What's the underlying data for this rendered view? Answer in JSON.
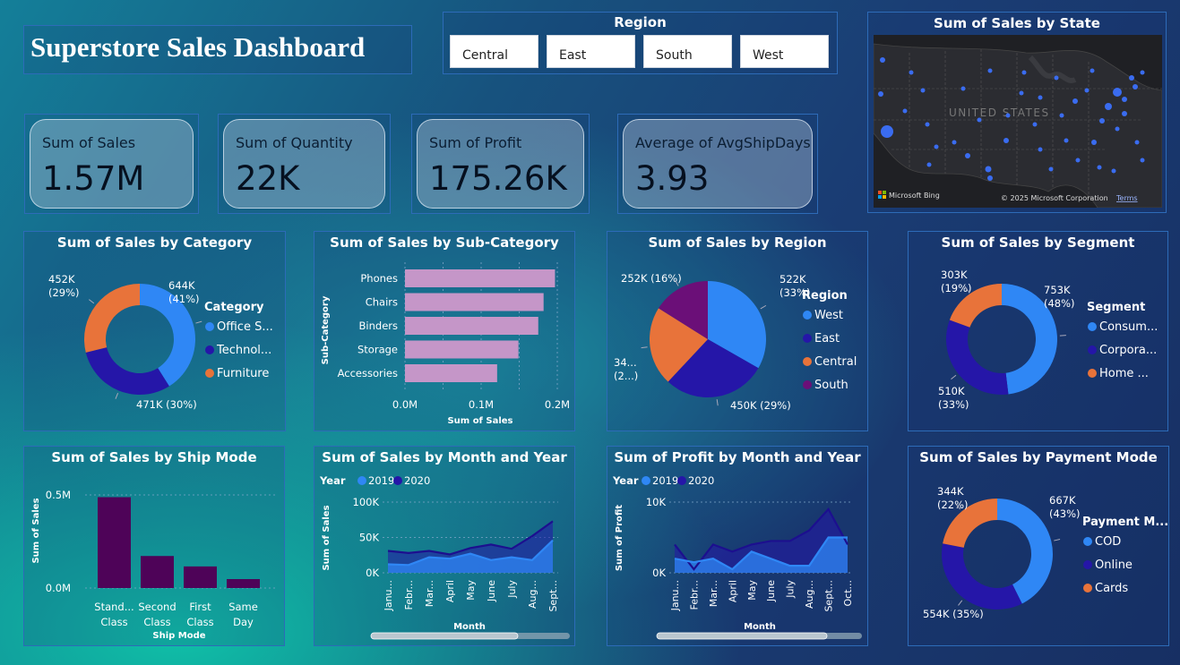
{
  "title": "Superstore Sales Dashboard",
  "region_slicer": {
    "title": "Region",
    "options": [
      "Central",
      "East",
      "South",
      "West"
    ]
  },
  "kpis": [
    {
      "label": "Sum of Sales",
      "value": "1.57M"
    },
    {
      "label": "Sum of Quantity",
      "value": "22K"
    },
    {
      "label": "Sum of Profit",
      "value": "175.26K"
    },
    {
      "label": "Average of AvgShipDays",
      "value": "3.93"
    }
  ],
  "map": {
    "title": "Sum of Sales by State",
    "country_label": "UNITED STATES",
    "bing_label": "Microsoft Bing",
    "copyright": "© 2025 Microsoft Corporation",
    "terms": "Terms"
  },
  "colors": {
    "blue": "#2f87f5",
    "navy": "#2516a8",
    "orange": "#e8733a",
    "purple": "#6b0f78",
    "bar_pink": "#c596c8",
    "bar_dark": "#4e0358"
  },
  "chart_data": [
    {
      "id": "category",
      "type": "pie",
      "title": "Sum of Sales by Category",
      "legend_title": "Category",
      "legend_items": [
        "Office S...",
        "Technol...",
        "Furniture"
      ],
      "categories": [
        "Office Supplies",
        "Technology",
        "Furniture"
      ],
      "values": [
        644,
        471,
        452
      ],
      "labels": [
        [
          "644K",
          "(41%)"
        ],
        [
          "471K (30%)"
        ],
        [
          "452K",
          "(29%)"
        ]
      ],
      "colors": [
        "#2f87f5",
        "#2516a8",
        "#e8733a"
      ]
    },
    {
      "id": "subcategory",
      "type": "bar",
      "title": "Sum of Sales by Sub-Category",
      "ylabel": "Sub-Category",
      "xlabel": "Sum of Sales",
      "categories": [
        "Phones",
        "Chairs",
        "Binders",
        "Storage",
        "Accessories"
      ],
      "values": [
        0.197,
        0.182,
        0.175,
        0.149,
        0.121
      ],
      "xticks": [
        "0.0M",
        "0.1M",
        "0.2M"
      ],
      "xlim": [
        0,
        0.2
      ]
    },
    {
      "id": "region",
      "type": "pie",
      "title": "Sum of Sales by Region",
      "legend_title": "Region",
      "legend_items": [
        "West",
        "East",
        "Central",
        "South"
      ],
      "values": [
        522,
        450,
        345,
        252
      ],
      "labels": [
        [
          "522K",
          "(33%)"
        ],
        [
          "450K (29%)"
        ],
        [
          "34...",
          "(2...)"
        ],
        [
          "252K (16%)"
        ]
      ],
      "colors": [
        "#2f87f5",
        "#2516a8",
        "#e8733a",
        "#6b0f78"
      ]
    },
    {
      "id": "segment",
      "type": "pie",
      "title": "Sum of Sales by Segment",
      "legend_title": "Segment",
      "legend_items": [
        "Consum...",
        "Corpora...",
        "Home ..."
      ],
      "values": [
        753,
        510,
        303
      ],
      "labels": [
        [
          "753K",
          "(48%)"
        ],
        [
          "510K",
          "(33%)"
        ],
        [
          "303K",
          "(19%)"
        ]
      ],
      "colors": [
        "#2f87f5",
        "#2516a8",
        "#e8733a"
      ]
    },
    {
      "id": "shipmode",
      "type": "bar",
      "title": "Sum of Sales by Ship Mode",
      "ylabel": "Sum of Sales",
      "xlabel": "Ship Mode",
      "categories": [
        [
          "Stand...",
          "Class"
        ],
        [
          "Second",
          "Class"
        ],
        [
          "First",
          "Class"
        ],
        [
          "Same",
          "Day"
        ]
      ],
      "values": [
        0.488,
        0.172,
        0.116,
        0.048
      ],
      "yticks": [
        "0.5M",
        "0.0M"
      ],
      "ylim": [
        0,
        0.5
      ]
    },
    {
      "id": "sales_month",
      "type": "area",
      "title": "Sum of Sales by Month and Year",
      "legend_title": "Year",
      "series_names": [
        "2019",
        "2020"
      ],
      "ylabel": "Sum of Sales",
      "xlabel": "Month",
      "x": [
        "Janu...",
        "Febr...",
        "Mar...",
        "April",
        "May",
        "June",
        "July",
        "Aug...",
        "Sept..."
      ],
      "yticks": [
        "100K",
        "50K",
        "0K"
      ],
      "ylim": [
        0,
        100
      ],
      "series": [
        {
          "name": "2019",
          "values": [
            12,
            11,
            22,
            20,
            27,
            18,
            22,
            18,
            46
          ]
        },
        {
          "name": "2020",
          "values": [
            31,
            28,
            31,
            26,
            35,
            40,
            34,
            52,
            73
          ]
        }
      ]
    },
    {
      "id": "profit_month",
      "type": "area",
      "title": "Sum of Profit by Month and Year",
      "legend_title": "Year",
      "series_names": [
        "2019",
        "2020"
      ],
      "ylabel": "Sum of Profit",
      "xlabel": "Month",
      "x": [
        "Janu...",
        "Febr...",
        "Mar...",
        "April",
        "May",
        "June",
        "July",
        "Aug...",
        "Sept...",
        "Oct..."
      ],
      "yticks": [
        "10K",
        "0K"
      ],
      "ylim": [
        0,
        10
      ],
      "series": [
        {
          "name": "2019",
          "values": [
            2,
            1.5,
            2,
            0.5,
            3,
            2,
            1,
            1,
            5,
            5
          ]
        },
        {
          "name": "2020",
          "values": [
            4,
            0.5,
            4,
            3,
            4,
            4.5,
            4.5,
            6,
            9,
            4
          ]
        }
      ]
    },
    {
      "id": "payment",
      "type": "pie",
      "title": "Sum of Sales by Payment Mode",
      "legend_title": "Payment M...",
      "legend_items": [
        "COD",
        "Online",
        "Cards"
      ],
      "values": [
        667,
        554,
        344
      ],
      "labels": [
        [
          "667K",
          "(43%)"
        ],
        [
          "554K (35%)"
        ],
        [
          "344K",
          "(22%)"
        ]
      ],
      "colors": [
        "#2f87f5",
        "#2516a8",
        "#e8733a"
      ]
    }
  ]
}
